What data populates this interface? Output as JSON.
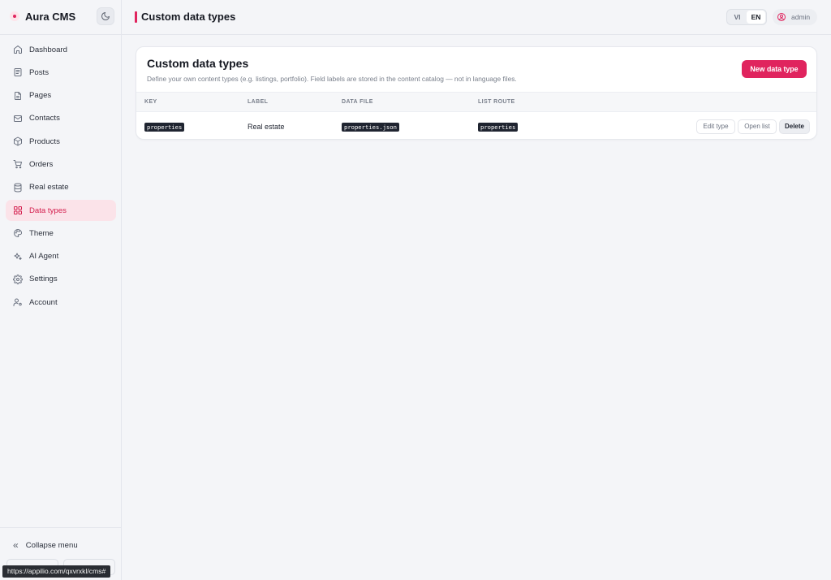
{
  "app": {
    "name": "Aura CMS"
  },
  "sidebar": {
    "items": [
      {
        "label": "Dashboard",
        "icon": "home-icon",
        "active": false
      },
      {
        "label": "Posts",
        "icon": "posts-icon",
        "active": false
      },
      {
        "label": "Pages",
        "icon": "page-icon",
        "active": false
      },
      {
        "label": "Contacts",
        "icon": "mail-icon",
        "active": false
      },
      {
        "label": "Products",
        "icon": "box-icon",
        "active": false
      },
      {
        "label": "Orders",
        "icon": "cart-icon",
        "active": false
      },
      {
        "label": "Real estate",
        "icon": "database-icon",
        "active": false
      },
      {
        "label": "Data types",
        "icon": "grid-icon",
        "active": true
      },
      {
        "label": "Theme",
        "icon": "palette-icon",
        "active": false
      },
      {
        "label": "AI Agent",
        "icon": "sparkle-icon",
        "active": false
      },
      {
        "label": "Settings",
        "icon": "gear-icon",
        "active": false
      },
      {
        "label": "Account",
        "icon": "user-gear-icon",
        "active": false
      }
    ],
    "collapse_label": "Collapse menu"
  },
  "header": {
    "title": "Custom data types",
    "languages": [
      "VI",
      "EN"
    ],
    "active_language": "EN",
    "user": "admin"
  },
  "card": {
    "title": "Custom data types",
    "description": "Define your own content types (e.g. listings, portfolio). Field labels are stored in the content catalog — not in language files.",
    "new_button": "New data type",
    "columns": [
      "KEY",
      "LABEL",
      "DATA FILE",
      "LIST ROUTE"
    ],
    "rows": [
      {
        "key": "properties",
        "label": "Real estate",
        "data_file": "properties.json",
        "list_route": "properties",
        "actions": {
          "edit": "Edit type",
          "open": "Open list",
          "delete": "Delete"
        }
      }
    ]
  },
  "status_url": "https://appilio.com/qxvrxkl/cms#",
  "colors": {
    "accent": "#e0245e",
    "active_bg": "#fbe3e9",
    "bg": "#f4f5f8"
  }
}
